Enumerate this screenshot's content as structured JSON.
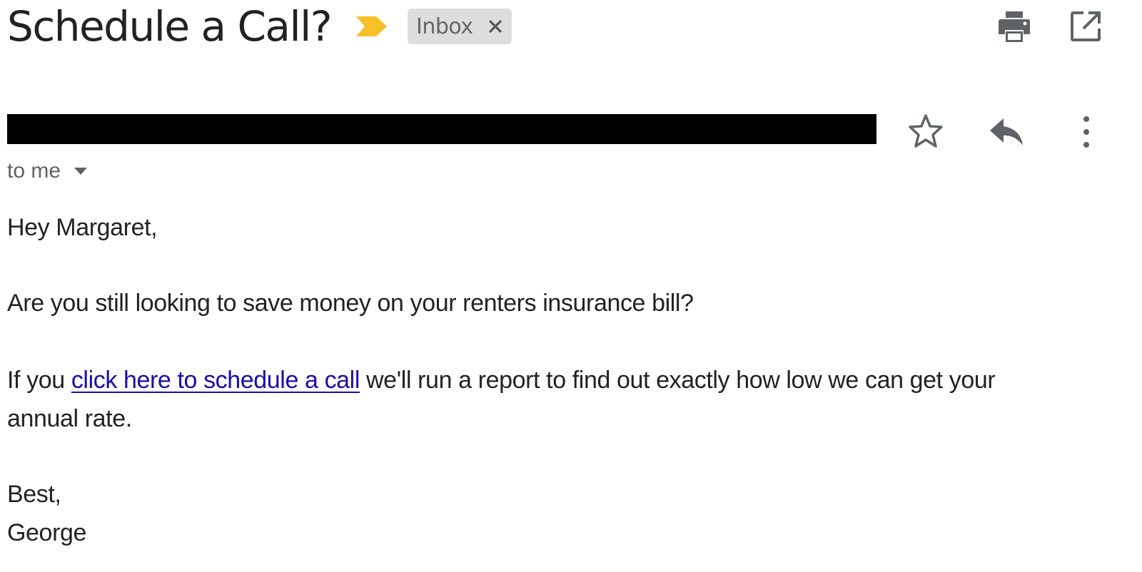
{
  "email": {
    "subject": "Schedule a Call?",
    "label_chip": "Inbox",
    "recipient": "to me",
    "greeting": "Hey Margaret,",
    "paragraph1": "Are you still looking to save money on your renters insurance bill?",
    "paragraph2_prefix": "If you ",
    "paragraph2_link": "click here to schedule a call",
    "paragraph2_suffix": " we'll run a report to find out exactly how low we can get your",
    "paragraph2_line2": "annual rate.",
    "closing": "Best,",
    "signature": "George"
  },
  "icons": {
    "importance": "important-marker-icon",
    "chip_close": "close-icon",
    "print": "print-icon",
    "new_window": "open-in-new-window-icon",
    "star": "star-outline-icon",
    "reply": "reply-icon",
    "more": "more-vertical-icon",
    "recipient_caret": "caret-down-icon"
  },
  "colors": {
    "important_marker": "#f6c026",
    "link": "#1a0dab",
    "chip_background": "#dddddd",
    "redaction": "#000000",
    "icon": "#5f6368"
  }
}
